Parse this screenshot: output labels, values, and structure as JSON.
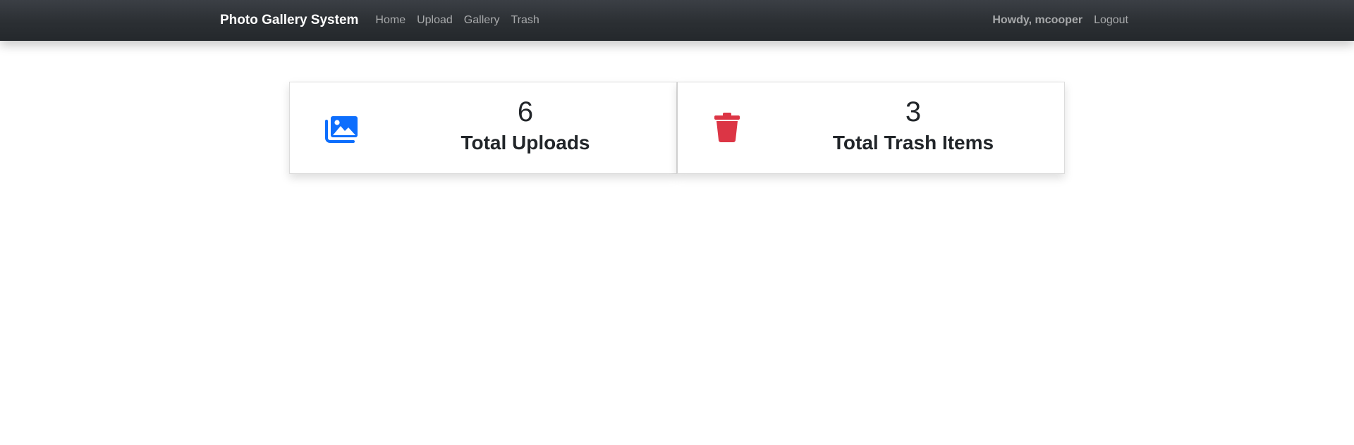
{
  "navbar": {
    "brand": "Photo Gallery System",
    "links": [
      {
        "label": "Home"
      },
      {
        "label": "Upload"
      },
      {
        "label": "Gallery"
      },
      {
        "label": "Trash"
      }
    ],
    "greeting": "Howdy, mcooper",
    "logout_label": "Logout"
  },
  "stats": [
    {
      "icon": "images-icon",
      "color": "#0d6efd",
      "value": "6",
      "label": "Total Uploads"
    },
    {
      "icon": "trash-icon",
      "color": "#dc3545",
      "value": "3",
      "label": "Total Trash Items"
    }
  ]
}
